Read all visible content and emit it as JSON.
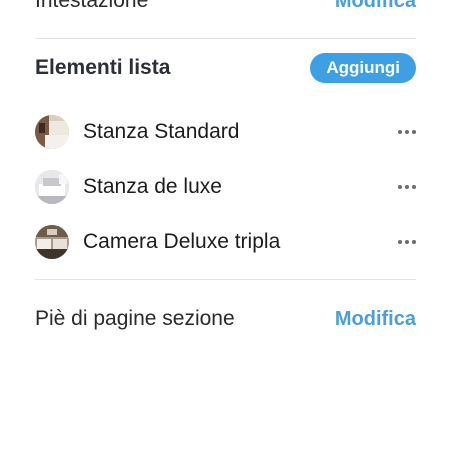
{
  "header": {
    "title": "Intestazione",
    "edit_label": "Modifica"
  },
  "list_section": {
    "title": "Elementi lista",
    "add_label": "Aggiungi",
    "items": [
      {
        "label": "Stanza Standard",
        "thumb_icon": "room-photo-icon"
      },
      {
        "label": "Stanza de luxe",
        "thumb_icon": "room-photo-icon"
      },
      {
        "label": "Camera Deluxe tripla",
        "thumb_icon": "room-photo-icon"
      }
    ]
  },
  "footer": {
    "title": "Piè di pagine sezione",
    "edit_label": "Modifica"
  },
  "colors": {
    "accent": "#3ea0e4",
    "link": "#4a9fd8",
    "divider": "#e2e2e4"
  }
}
